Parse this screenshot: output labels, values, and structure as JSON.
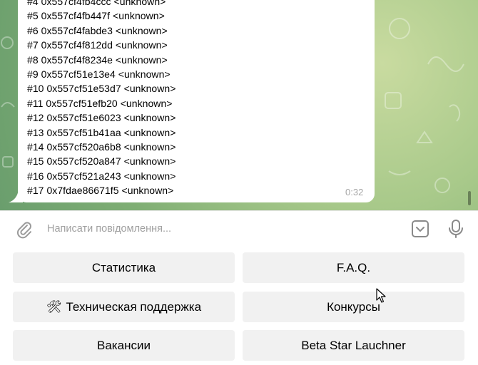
{
  "chat": {
    "log_lines": [
      "#4 0x557cf4fb4ccc <unknown>",
      "#5 0x557cf4fb447f <unknown>",
      "#6 0x557cf4fabde3 <unknown>",
      "#7 0x557cf4f812dd <unknown>",
      "#8 0x557cf4f8234e <unknown>",
      "#9 0x557cf51e13e4 <unknown>",
      "#10 0x557cf51e53d7 <unknown>",
      "#11 0x557cf51efb20 <unknown>",
      "#12 0x557cf51e6023 <unknown>",
      "#13 0x557cf51b41aa <unknown>",
      "#14 0x557cf520a6b8 <unknown>",
      "#15 0x557cf520a847 <unknown>",
      "#16 0x557cf521a243 <unknown>",
      "#17 0x7fdae86671f5 <unknown>"
    ],
    "time": "0:32"
  },
  "composer": {
    "placeholder": "Написати повідомлення...",
    "value": ""
  },
  "keyboard": {
    "buttons": [
      {
        "label": "Статистика",
        "icon": ""
      },
      {
        "label": "F.A.Q.",
        "icon": ""
      },
      {
        "label": "Техническая поддержка",
        "icon": "🛠"
      },
      {
        "label": "Конкурсы",
        "icon": ""
      },
      {
        "label": "Вакансии",
        "icon": ""
      },
      {
        "label": "Beta Star Lauchner",
        "icon": ""
      }
    ]
  },
  "icons": {
    "attach": "paperclip-icon",
    "keyboard": "keyboard-toggle-icon",
    "mic": "microphone-icon"
  }
}
